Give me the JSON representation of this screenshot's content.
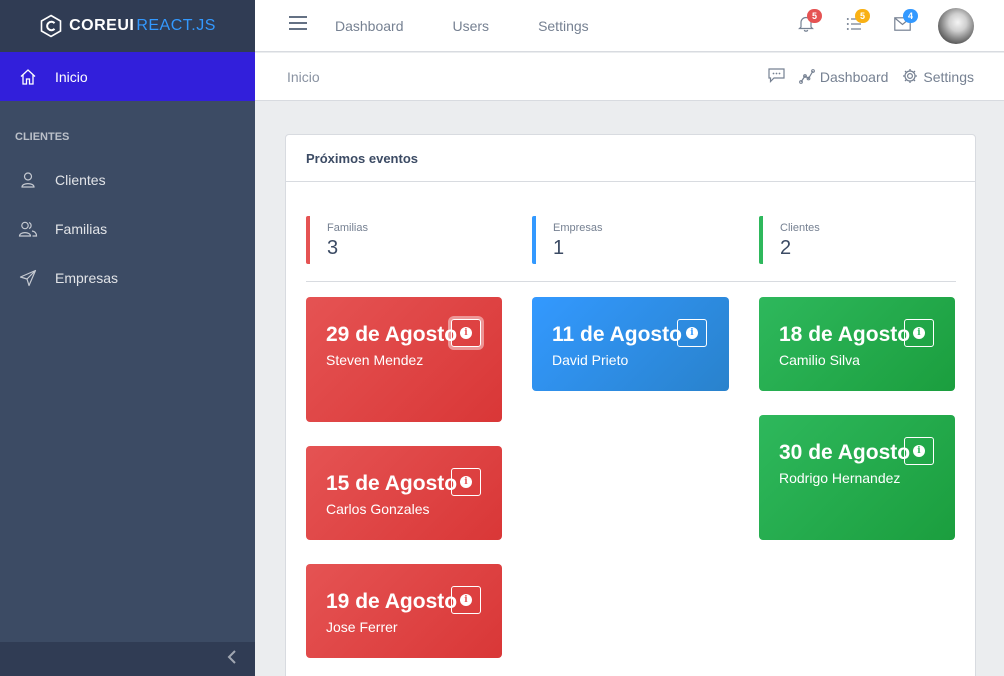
{
  "brand": {
    "part1": "COREUI",
    "part2": "REACT.JS"
  },
  "sidebar": {
    "items": [
      {
        "label": "Inicio",
        "icon": "home-icon",
        "active": true
      },
      {
        "label": "Clientes",
        "icon": "user-icon"
      },
      {
        "label": "Familias",
        "icon": "people-icon"
      },
      {
        "label": "Empresas",
        "icon": "send-icon"
      }
    ],
    "section_title": "CLIENTES"
  },
  "header": {
    "nav": [
      "Dashboard",
      "Users",
      "Settings"
    ],
    "badges": [
      {
        "icon": "bell-icon",
        "count": "5",
        "color": "#e55353"
      },
      {
        "icon": "list-icon",
        "count": "5",
        "color": "#f9b115"
      },
      {
        "icon": "envelope-icon",
        "count": "4",
        "color": "#3399ff"
      }
    ]
  },
  "subheader": {
    "breadcrumb": "Inicio",
    "links": [
      "Dashboard",
      "Settings"
    ]
  },
  "card": {
    "title": "Próximos eventos",
    "callouts": [
      {
        "label": "Familias",
        "value": "3",
        "color": "#e55353"
      },
      {
        "label": "Empresas",
        "value": "1",
        "color": "#3399ff"
      },
      {
        "label": "Clientes",
        "value": "2",
        "color": "#2eb85c"
      }
    ],
    "events": [
      {
        "date": "29 de Agosto",
        "name": "Steven Mendez",
        "color": "red"
      },
      {
        "date": "15 de Agosto",
        "name": "Carlos Gonzales",
        "color": "red"
      },
      {
        "date": "19 de Agosto",
        "name": "Jose Ferrer",
        "color": "red"
      },
      {
        "date": "11 de Agosto",
        "name": "David Prieto",
        "color": "blue"
      },
      {
        "date": "18 de Agosto",
        "name": "Camilio Silva",
        "color": "green"
      },
      {
        "date": "30 de Agosto",
        "name": "Rodrigo Hernandez",
        "color": "green"
      }
    ]
  }
}
